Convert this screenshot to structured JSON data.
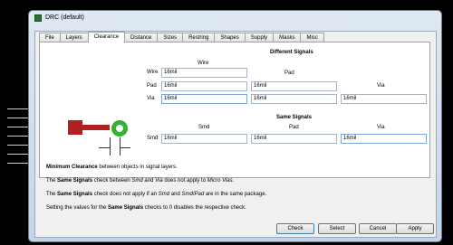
{
  "window": {
    "title": "DRC (default)"
  },
  "tabs": [
    {
      "label": "File"
    },
    {
      "label": "Layers"
    },
    {
      "label": "Clearance"
    },
    {
      "label": "Distance"
    },
    {
      "label": "Sizes"
    },
    {
      "label": "Restring"
    },
    {
      "label": "Shapes"
    },
    {
      "label": "Supply"
    },
    {
      "label": "Masks"
    },
    {
      "label": "Misc"
    }
  ],
  "active_tab": "Clearance",
  "different_signals": {
    "heading": "Different Signals",
    "col_wire": "Wire",
    "col_pad": "Pad",
    "col_via": "Via",
    "row_wire": "Wire",
    "row_pad": "Pad",
    "row_via": "Via",
    "wire_wire": "16mil",
    "pad_wire": "16mil",
    "pad_pad": "16mil",
    "via_wire": "16mil",
    "via_pad": "16mil",
    "via_via": "16mil"
  },
  "same_signals": {
    "heading": "Same Signals",
    "col_smd": "Smd",
    "col_pad": "Pad",
    "col_via": "Via",
    "row_smd": "Smd",
    "smd_smd": "16mil",
    "smd_pad": "16mil",
    "smd_via": "16mil"
  },
  "info": {
    "line1_bold": "Minimum Clearance",
    "line1_rest": " between objects in signal layers.",
    "line2_pre": "The ",
    "line2_bold": "Same Signals",
    "line2_mid": " check between ",
    "line2_it1": "Smd",
    "line2_and": " and ",
    "line2_it2": "Via",
    "line2_mid2": " does not apply to ",
    "line2_it3": "Micro Vias",
    "line2_end": ".",
    "line3_pre": "The ",
    "line3_bold": "Same Signals",
    "line3_mid": " check does not apply if an ",
    "line3_it1": "Smd",
    "line3_and": " and ",
    "line3_it2": "Smd",
    "line3_slash": "/",
    "line3_it3": "Pad",
    "line3_end": " are in the same package.",
    "line4_pre": "Setting the values for the ",
    "line4_bold": "Same Signals",
    "line4_end": " checks to 0 disables the respective check."
  },
  "buttons": {
    "check": "Check",
    "select": "Select",
    "cancel": "Cancel",
    "apply": "Apply"
  },
  "colors": {
    "pad": "#b02020",
    "via": "#32b232",
    "accent": "#3c7fb1"
  }
}
